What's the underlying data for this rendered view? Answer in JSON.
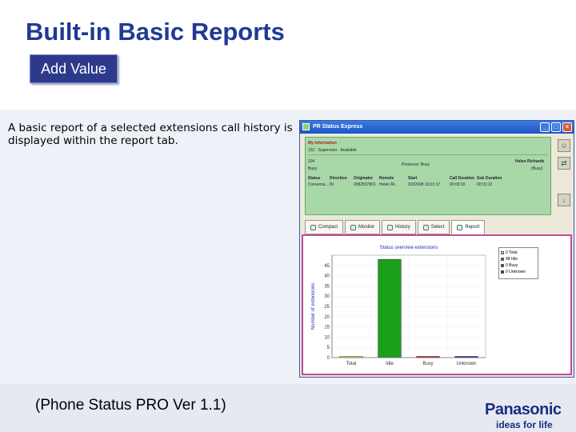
{
  "slide": {
    "title": "Built-in Basic Reports",
    "badge": "Add Value",
    "description": "A basic report of a selected extensions call history is displayed within the report tab.",
    "footer_note": "(Phone Status PRO Ver 1.1)",
    "brand": "Panasonic",
    "tagline": "ideas for life"
  },
  "app": {
    "title": "PR Status Express",
    "info": {
      "heading": "My Information",
      "line1": "132 : Supervisor · Available",
      "row_label": "104",
      "row_status": "Busy",
      "presence": "Presence: Busy",
      "user_name": "Helen Richards",
      "user_status": "(Busy)",
      "columns": [
        "Status",
        "Direction",
        "Originator",
        "Remote",
        "Start",
        "Call Duration",
        "Sub Duration"
      ],
      "row": [
        "Conversa...",
        "IN",
        "0082507801",
        "Helen Ri...",
        "3/3/2008 10:01:17",
        "00:00:10",
        "00:01:12"
      ]
    },
    "tabs": [
      {
        "label": "Compact",
        "icon": "compact-icon"
      },
      {
        "label": "Monitor",
        "icon": "monitor-icon"
      },
      {
        "label": "History",
        "icon": "history-icon"
      },
      {
        "label": "Select",
        "icon": "select-icon"
      },
      {
        "label": "Report",
        "icon": "report-icon"
      }
    ],
    "active_tab": "Report"
  },
  "chart_data": {
    "type": "bar",
    "title": "Status overview extensions",
    "ylabel": "Number of extensions",
    "xlabel": "",
    "categories": [
      "Total",
      "Idle",
      "Busy",
      "Unknown"
    ],
    "values": [
      0,
      48,
      0,
      0
    ],
    "colors": [
      "#f0e040",
      "#1aa01a",
      "#cc1a1a",
      "#2020c0"
    ],
    "ylim": [
      0,
      50
    ],
    "yticks": [
      0,
      5,
      10,
      15,
      20,
      25,
      30,
      35,
      40,
      45
    ],
    "grid": true,
    "legend": [
      "0 Total",
      "48 Idle",
      "0 Busy",
      "0 Unknown"
    ],
    "legend_position": "top-right"
  }
}
